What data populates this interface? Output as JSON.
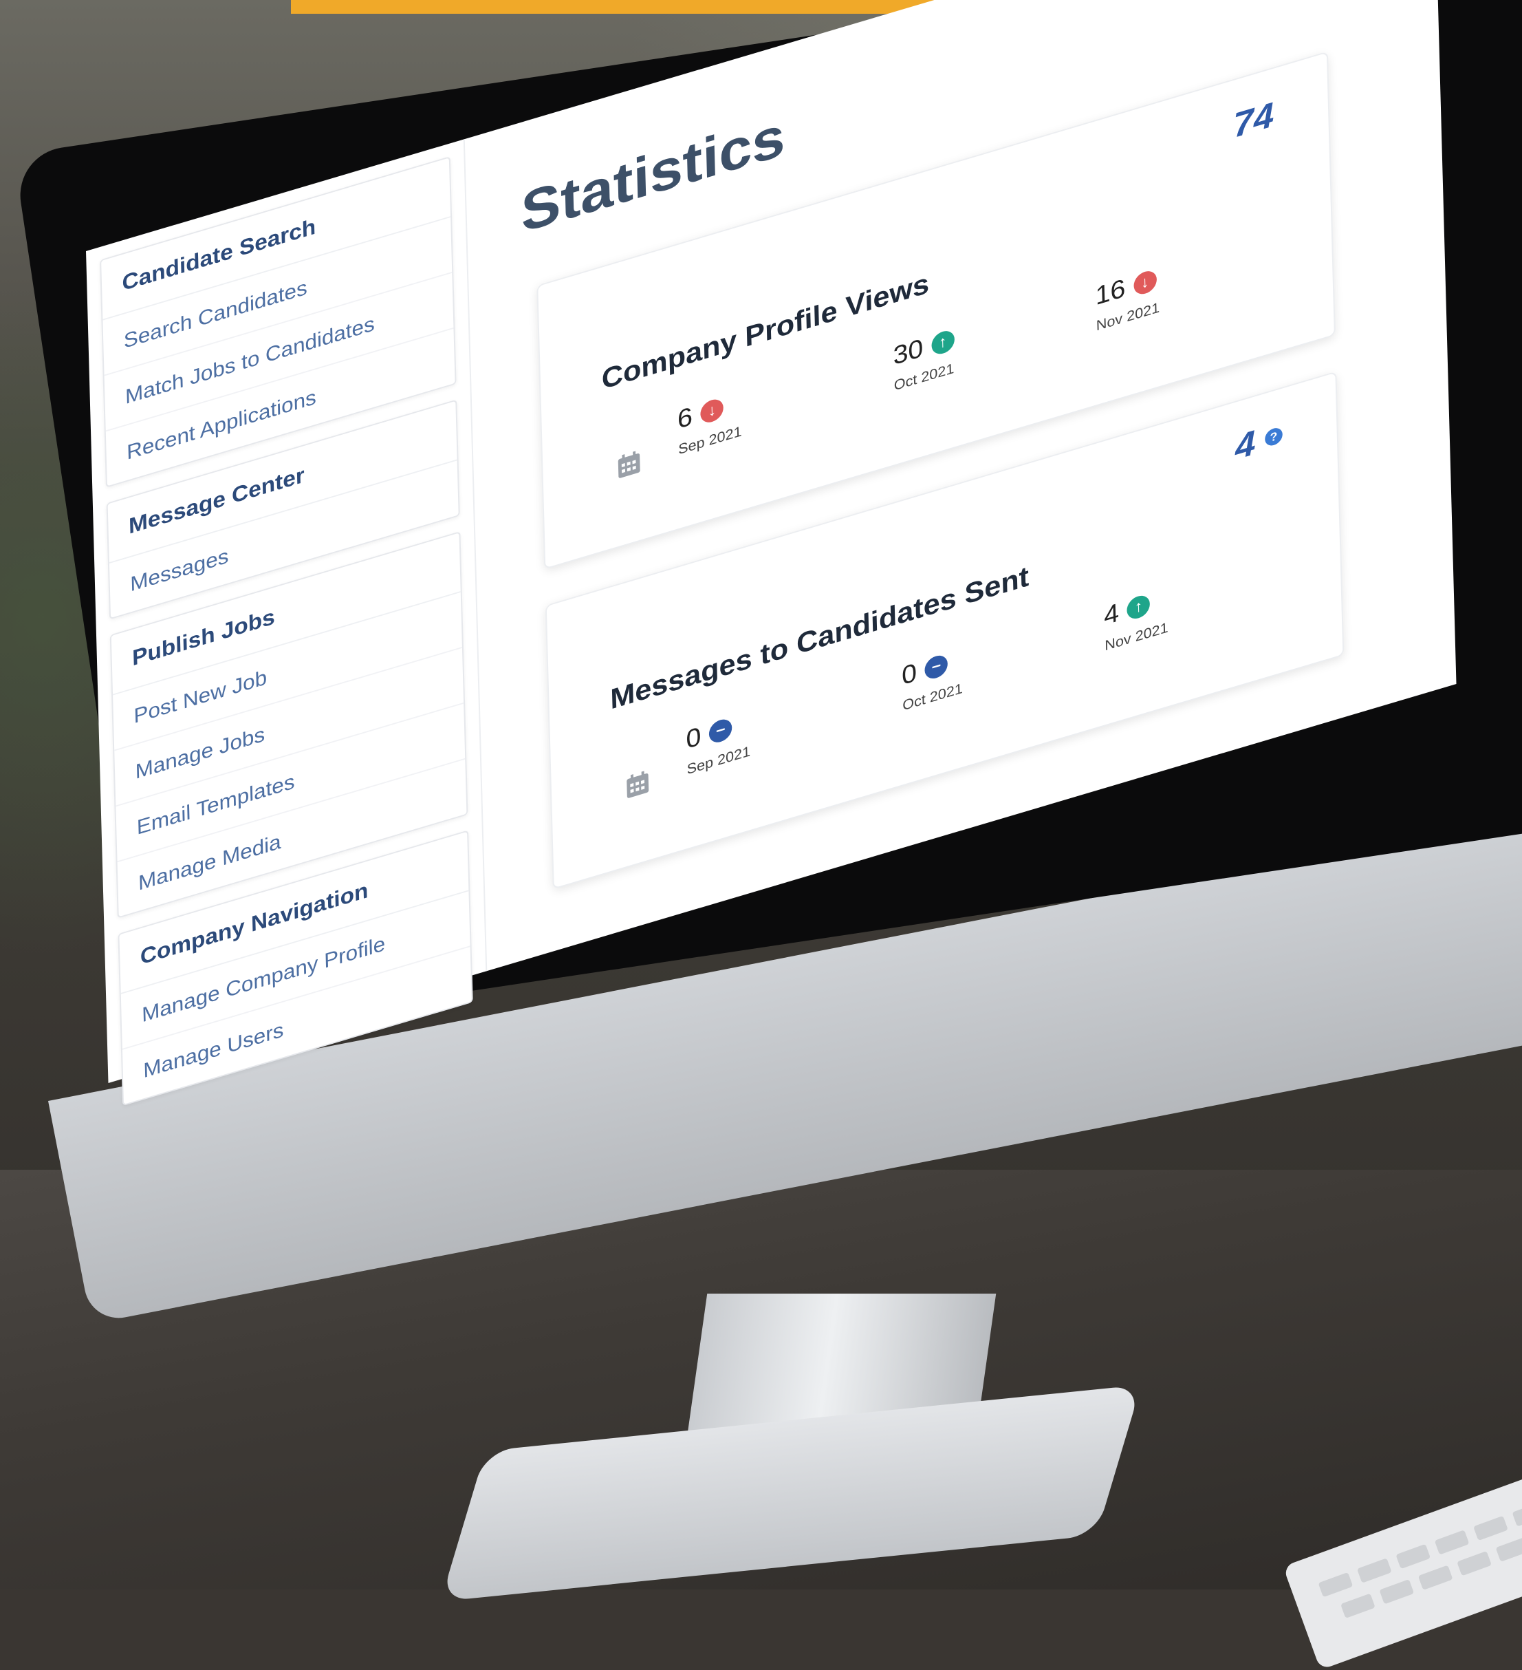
{
  "colors": {
    "accent_bar": "#f0a929",
    "down": "#e05a5a",
    "up": "#1ea58a",
    "neutral": "#2f5aa8",
    "title": "#3d5068"
  },
  "sidebar": {
    "groups": [
      {
        "heading": "Candidate Search",
        "items": [
          "Search Candidates",
          "Match Jobs to Candidates",
          "Recent Applications"
        ]
      },
      {
        "heading": "Message Center",
        "items": [
          "Messages"
        ]
      },
      {
        "heading": "Publish Jobs",
        "items": [
          "Post New Job",
          "Manage Jobs",
          "Email Templates",
          "Manage Media"
        ]
      },
      {
        "heading": "Company Navigation",
        "items": [
          "Manage Company Profile",
          "Manage Users"
        ]
      }
    ]
  },
  "main": {
    "title": "Statistics",
    "cards": [
      {
        "title": "Company Profile Views",
        "total": "74",
        "total_icon": "",
        "stats": [
          {
            "value": "6",
            "month": "Sep 2021",
            "trend_icon": "arrow-down-icon"
          },
          {
            "value": "30",
            "month": "Oct 2021",
            "trend_icon": "arrow-up-icon"
          },
          {
            "value": "16",
            "month": "Nov 2021",
            "trend_icon": "arrow-down-icon"
          }
        ]
      },
      {
        "title": "Messages to Candidates Sent",
        "total": "4",
        "total_icon": "help-icon",
        "stats": [
          {
            "value": "0",
            "month": "Sep 2021",
            "trend_icon": "minus-icon"
          },
          {
            "value": "0",
            "month": "Oct 2021",
            "trend_icon": "minus-icon"
          },
          {
            "value": "4",
            "month": "Nov 2021",
            "trend_icon": "arrow-up-icon"
          }
        ]
      }
    ]
  }
}
